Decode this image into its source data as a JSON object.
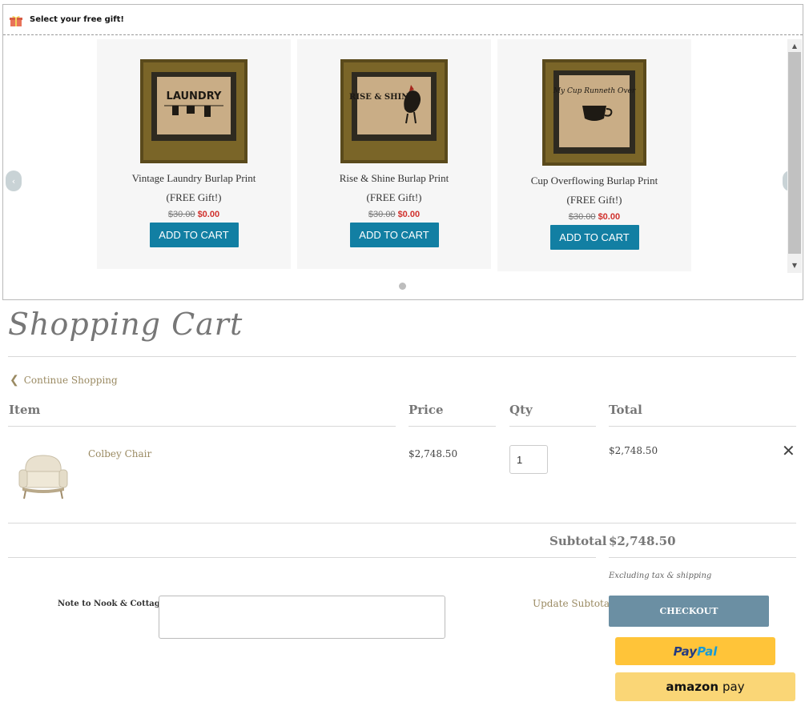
{
  "gift": {
    "title": "Select your free gift!",
    "prev_label": "‹",
    "next_label": "›",
    "products": [
      {
        "name": "Vintage Laundry Burlap Print",
        "free": "(FREE Gift!)",
        "old_price": "$30.00",
        "price": "$0.00",
        "button": "ADD TO CART",
        "art_text": "LAUNDRY"
      },
      {
        "name": "Rise & Shine Burlap Print",
        "free": "(FREE Gift!)",
        "old_price": "$30.00",
        "price": "$0.00",
        "button": "ADD TO CART",
        "art_text": "RISE & SHINE"
      },
      {
        "name": "Cup Overflowing Burlap Print",
        "free": "(FREE Gift!)",
        "old_price": "$30.00",
        "price": "$0.00",
        "button": "ADD TO CART",
        "art_text": "My Cup Runneth Over"
      }
    ]
  },
  "cart": {
    "title": "Shopping Cart",
    "continue_label": "Continue Shopping",
    "headers": {
      "item": "Item",
      "price": "Price",
      "qty": "Qty",
      "total": "Total"
    },
    "items": [
      {
        "name": "Colbey Chair",
        "price": "$2,748.50",
        "qty": "1",
        "total": "$2,748.50"
      }
    ],
    "subtotal_label": "Subtotal",
    "subtotal_value": "$2,748.50",
    "tax_note": "Excluding tax & shipping",
    "note_label": "Note to Nook & Cottage:",
    "update_label": "Update Subtotal",
    "checkout_label": "CHECKOUT",
    "paypal_label_1": "Pay",
    "paypal_label_2": "Pal",
    "amazon_label_1": "amazon",
    "amazon_label_2": "pay"
  },
  "colors": {
    "accent": "#127fa3",
    "sale": "#d0312d",
    "checkout": "#6b8fa3",
    "paypal": "#ffc439",
    "amazon": "#fad676",
    "link": "#9a8a62"
  }
}
